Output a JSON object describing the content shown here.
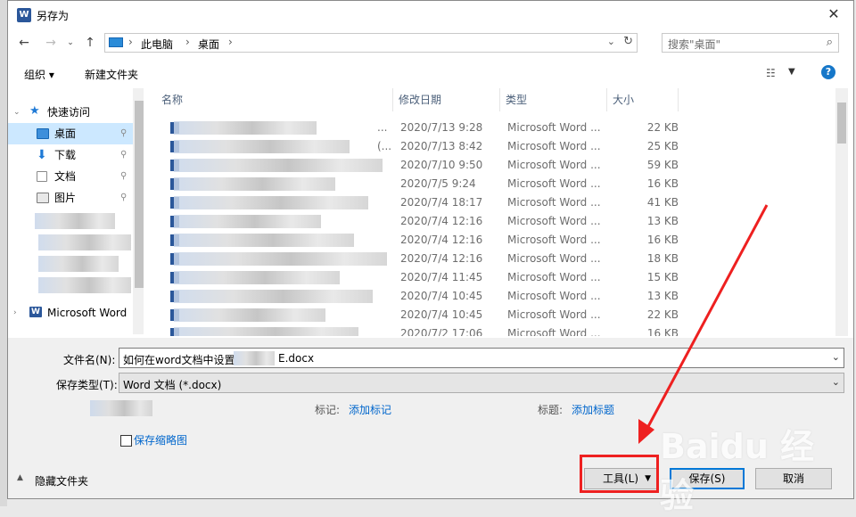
{
  "window": {
    "title": "另存为",
    "app_icon": "word-icon"
  },
  "navigation": {
    "path": [
      "此电脑",
      "桌面"
    ],
    "search_placeholder": "搜索\"桌面\""
  },
  "toolbar": {
    "organize": "组织 ▾",
    "new_folder": "新建文件夹"
  },
  "sidebar": {
    "items": [
      {
        "label": "快速访问",
        "icon": "star-icon"
      },
      {
        "label": "桌面",
        "icon": "desktop-icon",
        "selected": true
      },
      {
        "label": "下载",
        "icon": "download-icon"
      },
      {
        "label": "文档",
        "icon": "document-icon"
      },
      {
        "label": "图片",
        "icon": "pictures-icon"
      },
      {
        "label": "Microsoft Word",
        "icon": "word-icon"
      }
    ],
    "pin_icon": "📌"
  },
  "file_list": {
    "columns": [
      "名称",
      "修改日期",
      "类型",
      "大小"
    ],
    "rows": [
      {
        "date": "2020/7/13 9:28",
        "type": "Microsoft Word ...",
        "size": "22 KB",
        "name_suffix": "..."
      },
      {
        "date": "2020/7/13 8:42",
        "type": "Microsoft Word ...",
        "size": "25 KB",
        "name_suffix": "(..."
      },
      {
        "date": "2020/7/10 9:50",
        "type": "Microsoft Word ...",
        "size": "59 KB",
        "name_suffix": ""
      },
      {
        "date": "2020/7/5 9:24",
        "type": "Microsoft Word ...",
        "size": "16 KB",
        "name_suffix": ""
      },
      {
        "date": "2020/7/4 18:17",
        "type": "Microsoft Word ...",
        "size": "41 KB",
        "name_suffix": ""
      },
      {
        "date": "2020/7/4 12:16",
        "type": "Microsoft Word ...",
        "size": "13 KB",
        "name_suffix": ""
      },
      {
        "date": "2020/7/4 12:16",
        "type": "Microsoft Word ...",
        "size": "16 KB",
        "name_suffix": ""
      },
      {
        "date": "2020/7/4 12:16",
        "type": "Microsoft Word ...",
        "size": "18 KB",
        "name_suffix": ""
      },
      {
        "date": "2020/7/4 11:45",
        "type": "Microsoft Word ...",
        "size": "15 KB",
        "name_suffix": ""
      },
      {
        "date": "2020/7/4 10:45",
        "type": "Microsoft Word ...",
        "size": "13 KB",
        "name_suffix": ""
      },
      {
        "date": "2020/7/4 10:45",
        "type": "Microsoft Word ...",
        "size": "22 KB",
        "name_suffix": ""
      },
      {
        "date": "2020/7/2 17:06",
        "type": "Microsoft Word ...",
        "size": "16 KB",
        "name_suffix": ""
      }
    ]
  },
  "form": {
    "filename_label": "文件名(N):",
    "filename_value_prefix": "如何在word文档中设置",
    "filename_value_suffix": "E.docx",
    "filetype_label": "保存类型(T):",
    "filetype_value": "Word 文档 (*.docx)",
    "tags_label": "标记:",
    "tags_link": "添加标记",
    "title_label": "标题:",
    "title_link": "添加标题",
    "thumbnail_label": "保存缩略图"
  },
  "footer": {
    "hide_folders": "隐藏文件夹",
    "tools": "工具(L)",
    "save": "保存(S)",
    "cancel": "取消"
  },
  "watermark": "Baidu 经验",
  "colors": {
    "accent": "#0078d7",
    "highlight": "#ee2020",
    "selection": "#cce8ff"
  }
}
